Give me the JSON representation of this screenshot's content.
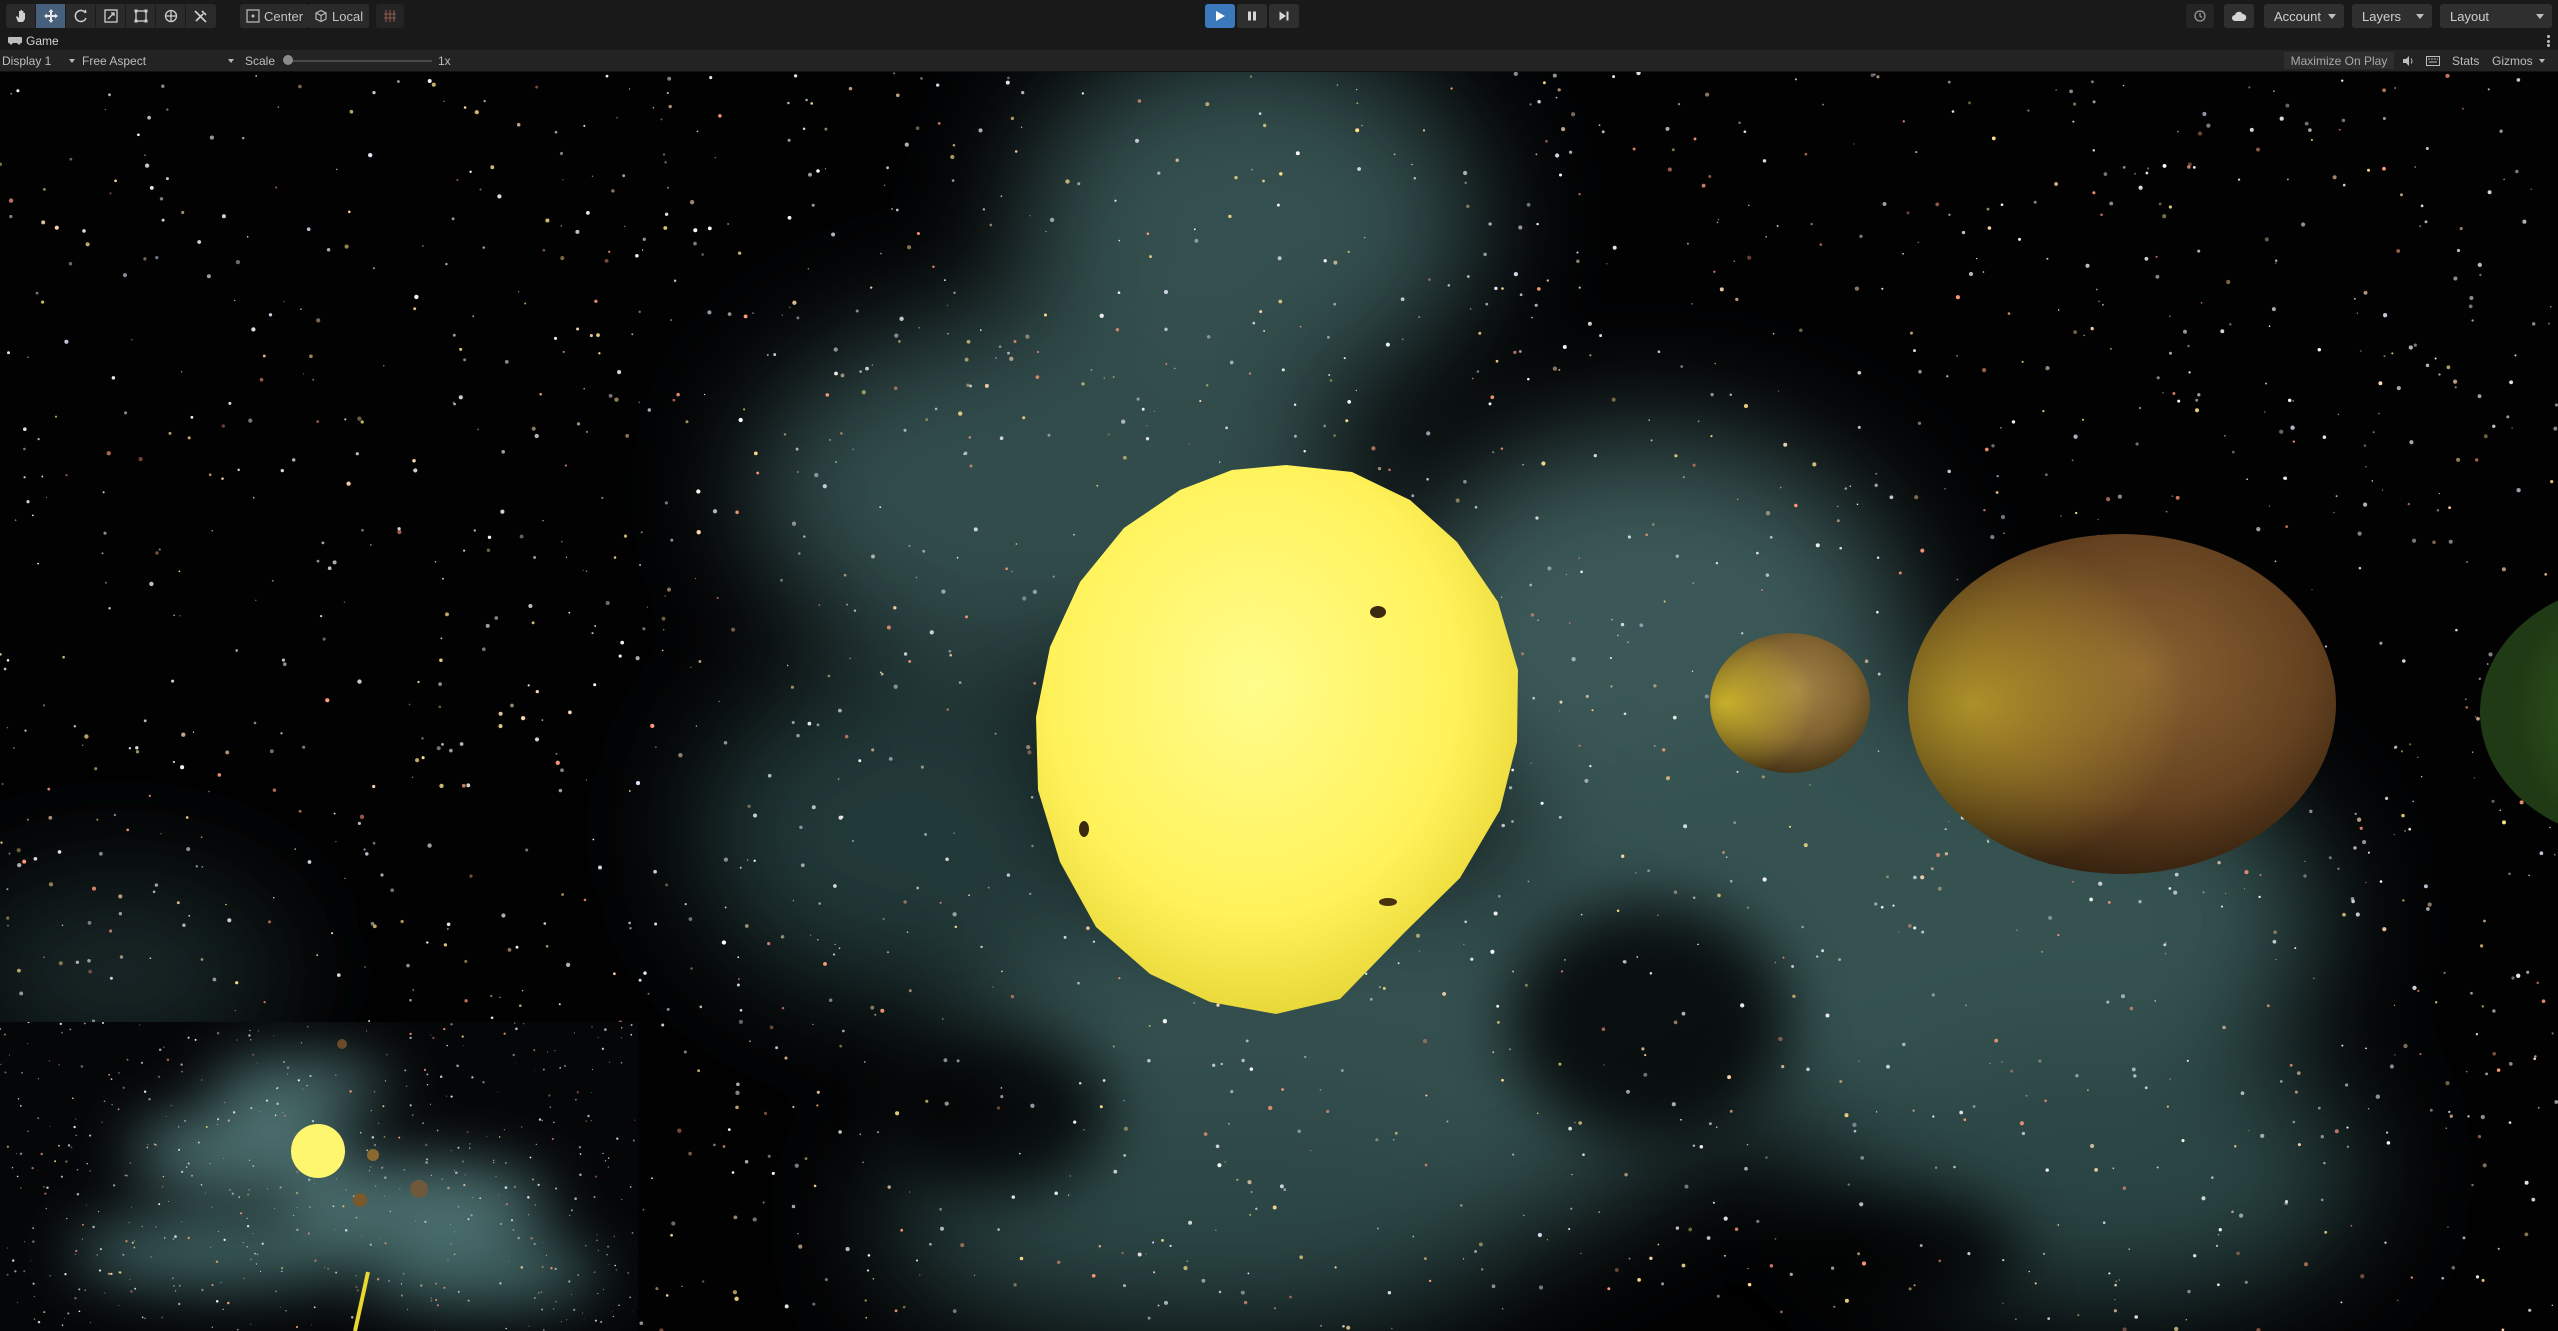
{
  "toolbar": {
    "tools": [
      {
        "name": "hand-tool",
        "active": false
      },
      {
        "name": "move-tool",
        "active": true
      },
      {
        "name": "rotate-tool",
        "active": false
      },
      {
        "name": "scale-tool",
        "active": false
      },
      {
        "name": "rect-tool",
        "active": false
      },
      {
        "name": "transform-tool",
        "active": false
      },
      {
        "name": "custom-tool",
        "active": false
      }
    ],
    "pivot_label": "Center",
    "rotation_label": "Local",
    "play_state": "playing",
    "account_label": "Account",
    "layers_label": "Layers",
    "layout_label": "Layout"
  },
  "tab": {
    "title": "Game"
  },
  "game_toolbar": {
    "display_label": "Display 1",
    "aspect_label": "Free Aspect",
    "scale_label": "Scale",
    "scale_value": "1x",
    "maximize_label": "Maximize On Play",
    "stats_label": "Stats",
    "gizmos_label": "Gizmos"
  },
  "scene": {
    "sun_color": "#fff96a",
    "nebula_color": "#6fa6a4",
    "planet_brown_color": "#6e4a22",
    "planet_small_color": "#9a7a30",
    "planet_green_color": "#3f6e2a"
  },
  "colors": {
    "toolbar_bg": "#191919",
    "gamebar_bg": "#232323",
    "play_active": "#3a79bb",
    "tool_active": "#46607c"
  }
}
